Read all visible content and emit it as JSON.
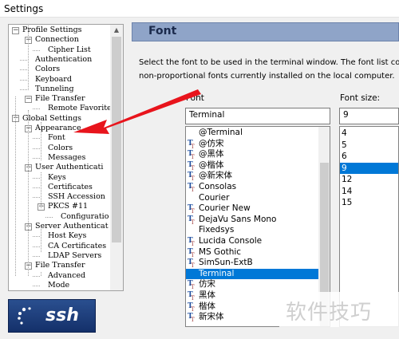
{
  "window": {
    "title": "Settings"
  },
  "tree": {
    "items": [
      {
        "label": "Profile Settings",
        "level": 0,
        "toggle": "−"
      },
      {
        "label": "Connection",
        "level": 1,
        "toggle": "−"
      },
      {
        "label": "Cipher List",
        "level": 2
      },
      {
        "label": "Authentication",
        "level": 1
      },
      {
        "label": "Colors",
        "level": 1
      },
      {
        "label": "Keyboard",
        "level": 1
      },
      {
        "label": "Tunneling",
        "level": 1
      },
      {
        "label": "File Transfer",
        "level": 1,
        "toggle": "−"
      },
      {
        "label": "Remote Favorite",
        "level": 2
      },
      {
        "label": "Global Settings",
        "level": 0,
        "toggle": "−"
      },
      {
        "label": "Appearance",
        "level": 1,
        "toggle": "−"
      },
      {
        "label": "Font",
        "level": 2
      },
      {
        "label": "Colors",
        "level": 2
      },
      {
        "label": "Messages",
        "level": 2
      },
      {
        "label": "User Authenticati",
        "level": 1,
        "toggle": "−"
      },
      {
        "label": "Keys",
        "level": 2
      },
      {
        "label": "Certificates",
        "level": 2
      },
      {
        "label": "SSH Accession",
        "level": 2
      },
      {
        "label": "PKCS #11",
        "level": 2,
        "toggle": "−"
      },
      {
        "label": "Configuratio",
        "level": 3
      },
      {
        "label": "Server Authenticat",
        "level": 1,
        "toggle": "−"
      },
      {
        "label": "Host Keys",
        "level": 2
      },
      {
        "label": "CA Certificates",
        "level": 2
      },
      {
        "label": "LDAP Servers",
        "level": 2
      },
      {
        "label": "File Transfer",
        "level": 1,
        "toggle": "−"
      },
      {
        "label": "Advanced",
        "level": 2
      },
      {
        "label": "Mode",
        "level": 2
      }
    ]
  },
  "logo": {
    "text": "ssh"
  },
  "panel": {
    "title": "Font",
    "description_line1": "Select the font to be used in the terminal window. The font list co",
    "description_line2": "non-proportional fonts currently installed on the local computer."
  },
  "font": {
    "label": "Font",
    "value": "Terminal",
    "options": [
      {
        "name": "@Terminal",
        "tt": false
      },
      {
        "name": "@仿宋",
        "tt": true
      },
      {
        "name": "@黑体",
        "tt": true
      },
      {
        "name": "@楷体",
        "tt": true
      },
      {
        "name": "@新宋体",
        "tt": true
      },
      {
        "name": "Consolas",
        "tt": true
      },
      {
        "name": "Courier",
        "tt": false
      },
      {
        "name": "Courier New",
        "tt": true
      },
      {
        "name": "DejaVu Sans Mono",
        "tt": true
      },
      {
        "name": "Fixedsys",
        "tt": false
      },
      {
        "name": "Lucida Console",
        "tt": true
      },
      {
        "name": "MS Gothic",
        "tt": true
      },
      {
        "name": "SimSun-ExtB",
        "tt": true
      },
      {
        "name": "Terminal",
        "tt": false,
        "selected": true
      },
      {
        "name": "仿宋",
        "tt": true
      },
      {
        "name": "黑体",
        "tt": true
      },
      {
        "name": "楷体",
        "tt": true
      },
      {
        "name": "新宋体",
        "tt": true
      }
    ]
  },
  "font_size": {
    "label": "Font size:",
    "value": "9",
    "options": [
      {
        "size": "4"
      },
      {
        "size": "5"
      },
      {
        "size": "6"
      },
      {
        "size": "9",
        "selected": true
      },
      {
        "size": "12"
      },
      {
        "size": "14"
      },
      {
        "size": "15"
      }
    ]
  },
  "watermark": {
    "text": "软件技巧"
  },
  "colors": {
    "header_bg": "#8fa4c8",
    "selection": "#0078d7",
    "arrow": "#e8141c",
    "logo_bg": "#1f3f7c"
  }
}
